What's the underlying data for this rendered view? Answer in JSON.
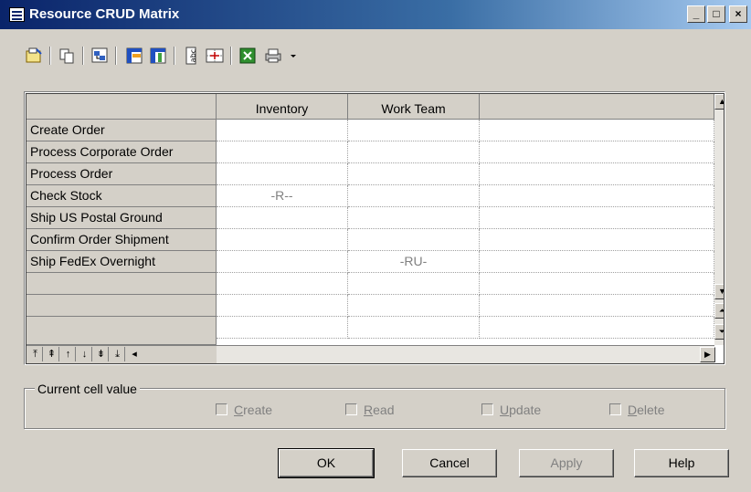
{
  "window": {
    "title": "Resource CRUD Matrix",
    "accent": "#0a246a"
  },
  "titlebar_buttons": {
    "minimize": "_",
    "maximize": "□",
    "close": "×"
  },
  "toolbar": {
    "icons": [
      "properties-icon",
      "copy-icon",
      "find-object-icon",
      "select-rows-icon",
      "select-columns-icon",
      "text-orientation-icon",
      "grid-options-icon",
      "export-excel-icon",
      "print-icon"
    ]
  },
  "matrix": {
    "columns": [
      "Inventory",
      "Work Team",
      ""
    ],
    "rows": [
      {
        "label": "Create Order",
        "cells": [
          "",
          "",
          ""
        ]
      },
      {
        "label": "Process Corporate Order",
        "cells": [
          "",
          "",
          ""
        ]
      },
      {
        "label": "Process Order",
        "cells": [
          "",
          "",
          ""
        ]
      },
      {
        "label": "Check Stock",
        "cells": [
          "-R--",
          "",
          ""
        ]
      },
      {
        "label": "Ship US Postal Ground",
        "cells": [
          "",
          "",
          ""
        ]
      },
      {
        "label": "Confirm Order Shipment",
        "cells": [
          "",
          "",
          ""
        ]
      },
      {
        "label": "Ship FedEx Overnight",
        "cells": [
          "",
          "-RU-",
          ""
        ]
      },
      {
        "label": "",
        "cells": [
          "",
          "",
          ""
        ]
      },
      {
        "label": "",
        "cells": [
          "",
          "",
          ""
        ]
      },
      {
        "label": "",
        "cells": [
          "",
          "",
          ""
        ]
      }
    ]
  },
  "current_cell": {
    "group_label": "Current cell value",
    "checkboxes": [
      {
        "key": "C",
        "rest": "reate",
        "checked": false
      },
      {
        "key": "R",
        "rest": "ead",
        "checked": false
      },
      {
        "key": "U",
        "rest": "pdate",
        "checked": false
      },
      {
        "key": "D",
        "rest": "elete",
        "checked": false
      }
    ]
  },
  "buttons": {
    "ok": "OK",
    "cancel": "Cancel",
    "apply": "Apply",
    "help": "Help"
  }
}
